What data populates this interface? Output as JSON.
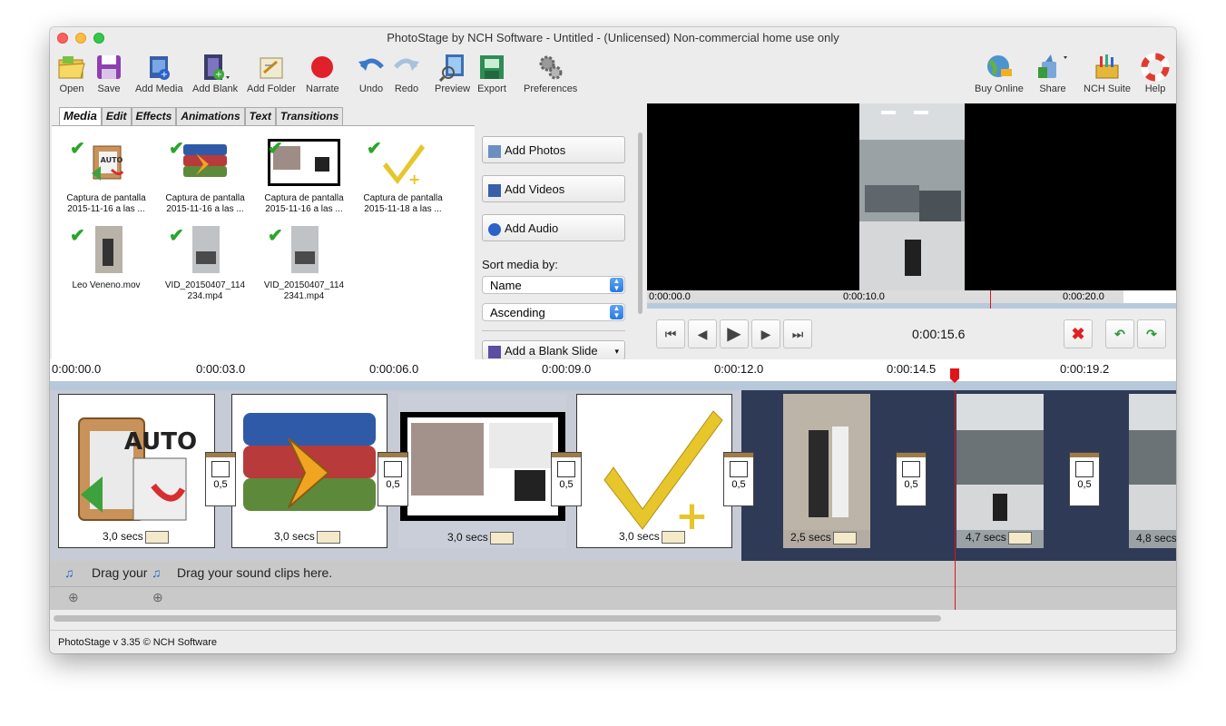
{
  "window": {
    "title": "PhotoStage by NCH Software - Untitled - (Unlicensed) Non-commercial home use only"
  },
  "toolbar": {
    "open": "Open",
    "save": "Save",
    "add_media": "Add Media",
    "add_blank": "Add Blank",
    "add_folder": "Add Folder",
    "narrate": "Narrate",
    "undo": "Undo",
    "redo": "Redo",
    "preview": "Preview",
    "export": "Export",
    "preferences": "Preferences",
    "buy_online": "Buy Online",
    "share": "Share",
    "nch_suite": "NCH Suite",
    "help": "Help"
  },
  "tabs": [
    "Media",
    "Edit",
    "Effects",
    "Animations",
    "Text",
    "Transitions"
  ],
  "media_items": [
    {
      "line1": "Captura de pantalla",
      "line2": "2015-11-16 a las ..."
    },
    {
      "line1": "Captura de pantalla",
      "line2": "2015-11-16 a las ..."
    },
    {
      "line1": "Captura de pantalla",
      "line2": "2015-11-16 a las ..."
    },
    {
      "line1": "Captura de pantalla",
      "line2": "2015-11-18 a las ..."
    },
    {
      "line1": "Leo Veneno.mov",
      "line2": ""
    },
    {
      "line1": "VID_20150407_114",
      "line2": "234.mp4"
    },
    {
      "line1": "VID_20150407_114",
      "line2": "2341.mp4"
    }
  ],
  "media_buttons": {
    "add_photos": "Add Photos",
    "add_videos": "Add Videos",
    "add_audio": "Add Audio",
    "sort_label": "Sort media by:",
    "sort_by": "Name",
    "sort_order": "Ascending",
    "add_blank_slide": "Add a Blank Slide"
  },
  "preview": {
    "ruler": [
      "0:00:00.0",
      "0:00:10.0",
      "0:00:20.0"
    ],
    "current_time": "0:00:15.6"
  },
  "timeline": {
    "ruler": [
      "0:00:00.0",
      "0:00:03.0",
      "0:00:06.0",
      "0:00:09.0",
      "0:00:12.0",
      "0:00:14.5",
      "0:00:19.2"
    ],
    "clips": [
      "3,0 secs",
      "3,0 secs",
      "3,0 secs",
      "3,0 secs",
      "2,5 secs",
      "4,7 secs",
      "4,8 secs"
    ],
    "transitions": [
      "0,5",
      "0,5",
      "0,5",
      "0,5",
      "0,5",
      "0,5"
    ],
    "sound_hint_short": "Drag your",
    "sound_hint": "Drag your sound clips here."
  },
  "status": {
    "text": "PhotoStage v 3.35 © NCH Software"
  },
  "colors": {
    "playhead": "#e01515",
    "video_track_bg": "#2f3a56",
    "check": "#2aa52a",
    "select_accent": "#2a79e0"
  }
}
